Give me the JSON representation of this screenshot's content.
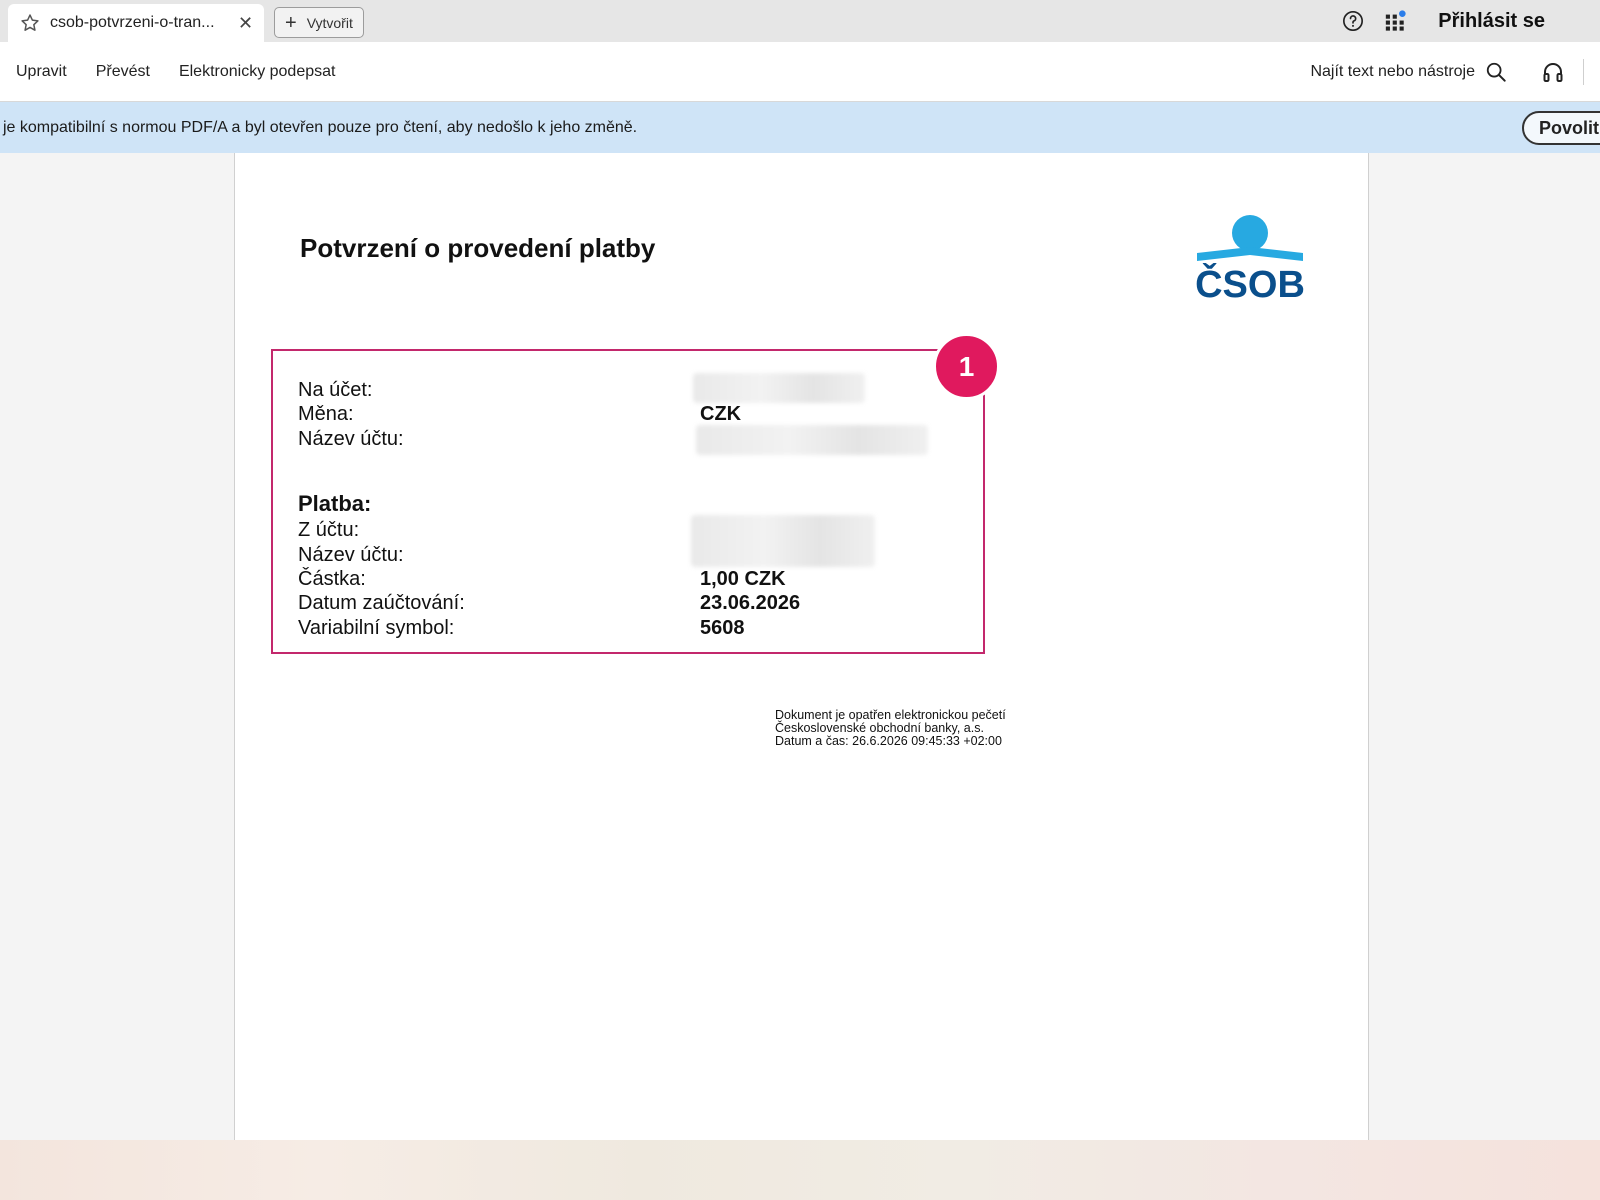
{
  "tab": {
    "title": "csob-potvrzeni-o-tran...",
    "close_glyph": "✕",
    "new_tab_label": "Vytvořit",
    "plus_glyph": "+",
    "icons": [
      "star-icon",
      "close-icon",
      "plus-icon",
      "help-icon",
      "apps-icon"
    ]
  },
  "header": {
    "sign_in_label": "Přihlásit se",
    "notification_color": "#2b7de9"
  },
  "toolbar": {
    "menu": [
      {
        "label": "Upravit"
      },
      {
        "label": "Převést"
      },
      {
        "label": "Elektronicky podepsat"
      }
    ],
    "search_label": "Najít text nebo nástroje",
    "icons": [
      "search-icon",
      "headphones-icon"
    ]
  },
  "banner": {
    "text": "je kompatibilní s normou PDF/A a byl otevřen pouze pro čtení, aby nedošlo k jeho změně.",
    "button_label": "Povolit",
    "background": "#cfe4f7"
  },
  "document": {
    "title": "Potvrzení o provedení platby",
    "logo_text": "ČSOB",
    "logo_color": "#0a4f8c",
    "logo_accent": "#27a9e1",
    "badge_number": "1",
    "badge_color": "#e0195e",
    "box_border_color": "#c3286c",
    "account": {
      "to_account_label": "Na účet:",
      "currency_label": "Měna:",
      "currency_value": "CZK",
      "account_name_label": "Název účtu:"
    },
    "payment": {
      "heading": "Platba:",
      "from_account_label": "Z účtu:",
      "account_name_label": "Název účtu:",
      "amount_label": "Částka:",
      "amount_value": "1,00 CZK",
      "posting_date_label": "Datum zaúčtování:",
      "posting_date_value": "23.06.2026",
      "variable_symbol_label": "Variabilní symbol:",
      "variable_symbol_value": "5608"
    },
    "seal": {
      "line1": "Dokument je opatřen elektronickou pečetí",
      "line2": "Československé obchodní banky, a.s.",
      "line3": "Datum a čas: 26.6.2026 09:45:33 +02:00"
    }
  }
}
